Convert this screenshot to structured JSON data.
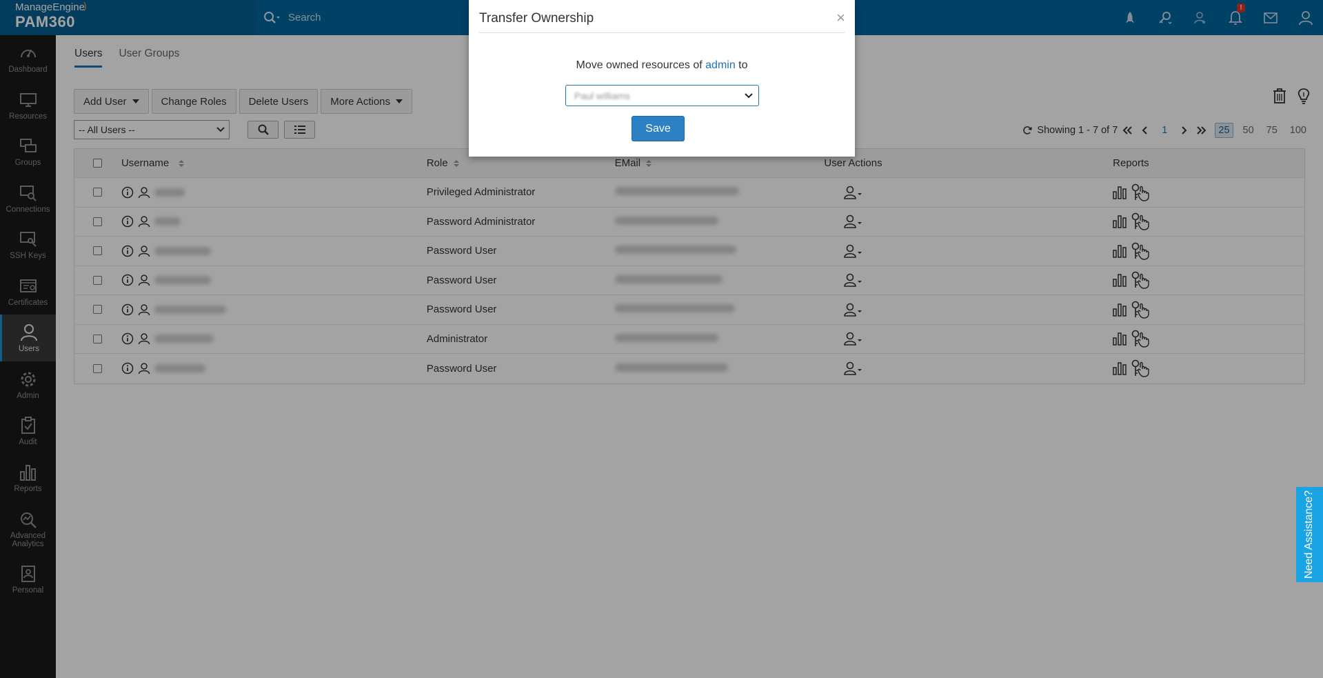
{
  "brand": {
    "line1": "ManageEngine",
    "line2": "PAM360"
  },
  "search": {
    "placeholder": "Search"
  },
  "topbar": {
    "notification_badge": "!"
  },
  "sidebar": {
    "items": [
      {
        "label": "Dashboard",
        "icon": "dashboard-icon"
      },
      {
        "label": "Resources",
        "icon": "monitor-icon"
      },
      {
        "label": "Groups",
        "icon": "groups-icon"
      },
      {
        "label": "Connections",
        "icon": "connections-icon"
      },
      {
        "label": "SSH Keys",
        "icon": "ssh-key-icon"
      },
      {
        "label": "Certificates",
        "icon": "certificate-icon"
      },
      {
        "label": "Users",
        "icon": "user-icon"
      },
      {
        "label": "Admin",
        "icon": "gear-icon"
      },
      {
        "label": "Audit",
        "icon": "clipboard-check-icon"
      },
      {
        "label": "Reports",
        "icon": "bar-chart-icon"
      },
      {
        "label": "Advanced Analytics",
        "icon": "analytics-icon"
      },
      {
        "label": "Personal",
        "icon": "personal-icon"
      }
    ]
  },
  "tabs": [
    {
      "label": "Users"
    },
    {
      "label": "User Groups"
    }
  ],
  "toolbar": {
    "add_user": "Add User",
    "change_roles": "Change Roles",
    "delete_users": "Delete Users",
    "more_actions": "More Actions"
  },
  "filter": {
    "selected": "-- All Users --"
  },
  "pager": {
    "showing": "Showing 1 - 7 of 7",
    "page": "1",
    "sizes": [
      "25",
      "50",
      "75",
      "100"
    ],
    "selected_size": "25"
  },
  "table": {
    "headers": {
      "username": "Username",
      "role": "Role",
      "email": "EMail",
      "user_actions": "User Actions",
      "reports": "Reports"
    },
    "rows": [
      {
        "role": "Privileged Administrator"
      },
      {
        "role": "Password Administrator"
      },
      {
        "role": "Password User"
      },
      {
        "role": "Password User"
      },
      {
        "role": "Password User"
      },
      {
        "role": "Administrator"
      },
      {
        "role": "Password User"
      }
    ]
  },
  "modal": {
    "title": "Transfer Ownership",
    "close": "×",
    "text_before": "Move owned resources of",
    "owner": "admin",
    "text_after": "to",
    "select_value": "Paul williams",
    "save": "Save"
  },
  "assist": {
    "label": "Need Assistance?"
  },
  "colors": {
    "topbar": "#0067a0",
    "sidebar": "#1a1a1a",
    "accent": "#1d75bb",
    "save_button": "#2c80c4",
    "assist": "#1aa4e3"
  }
}
